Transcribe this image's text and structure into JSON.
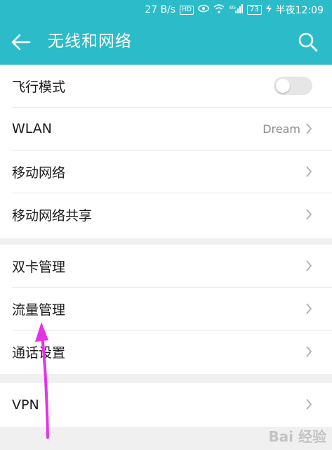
{
  "status_bar": {
    "speed": "27 B/s",
    "hd_label": "HD",
    "battery": "73",
    "time": "半夜12:09"
  },
  "app_bar": {
    "title": "无线和网络",
    "back_icon": "arrow-left-icon",
    "search_icon": "search-icon",
    "background_color": "#2cbcc9"
  },
  "settings": {
    "airplane_mode": {
      "label": "飞行模式",
      "enabled": false
    },
    "wlan": {
      "label": "WLAN",
      "value": "Dream"
    },
    "mobile_network": {
      "label": "移动网络"
    },
    "tethering": {
      "label": "移动网络共享"
    },
    "dual_sim": {
      "label": "双卡管理"
    },
    "data_usage": {
      "label": "流量管理"
    },
    "call_settings": {
      "label": "通话设置"
    },
    "vpn": {
      "label": "VPN"
    }
  },
  "annotation": {
    "arrow_color": "#e632e6"
  },
  "watermark": "Bai 经验"
}
